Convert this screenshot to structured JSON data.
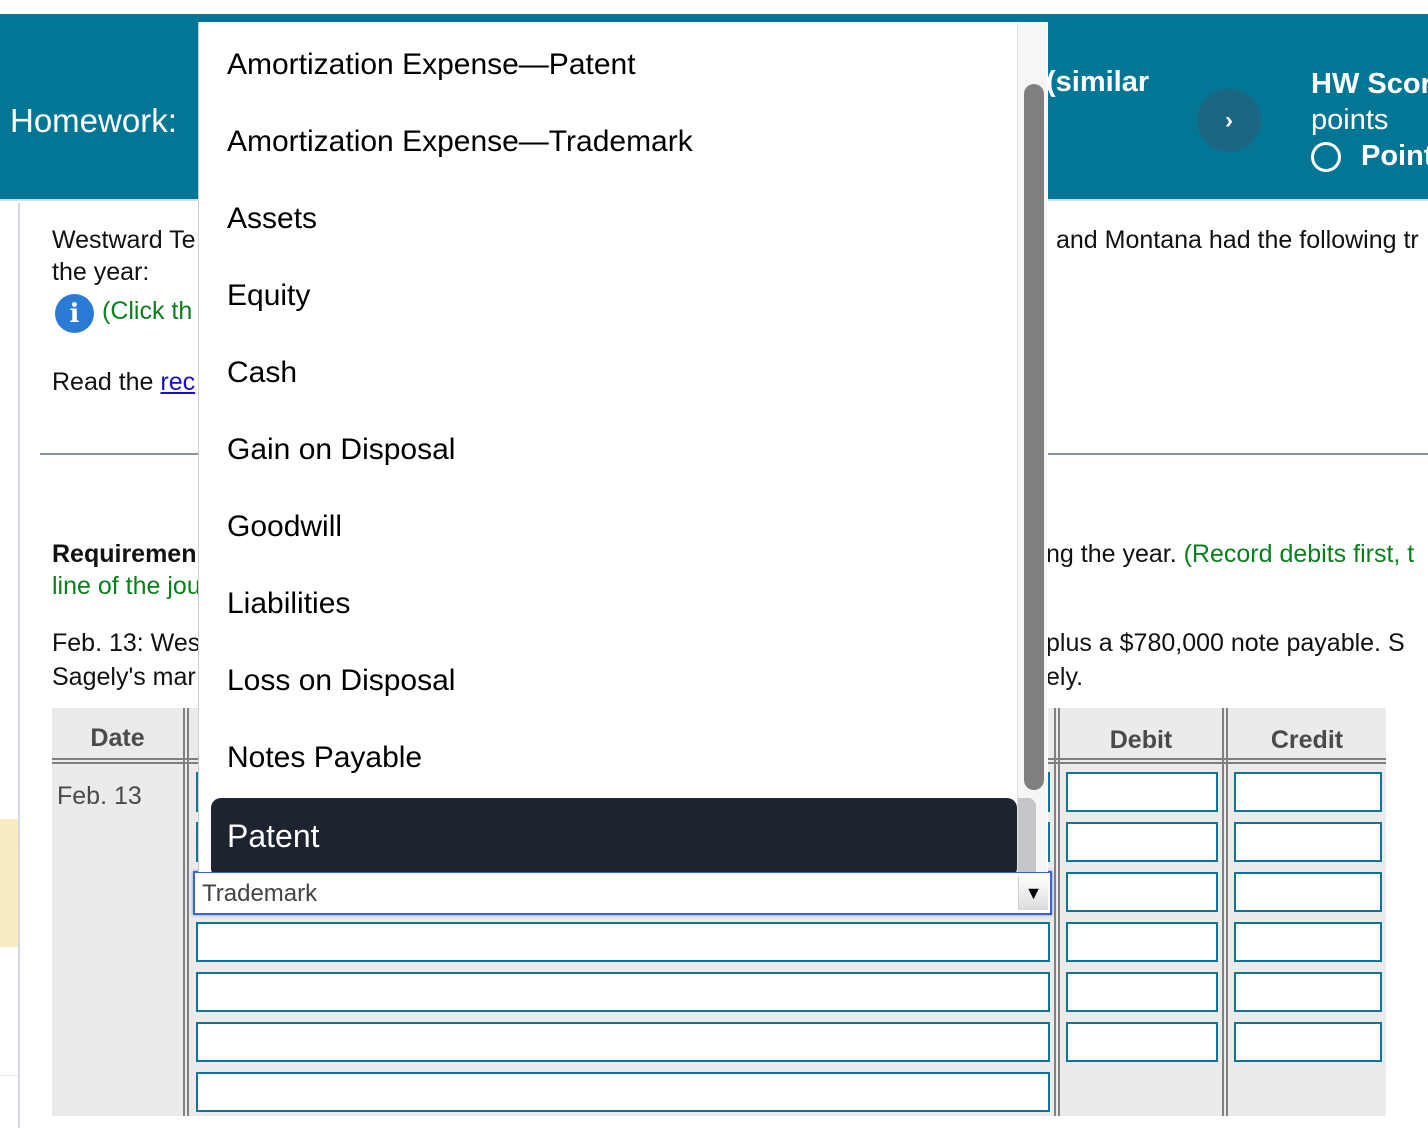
{
  "header": {
    "title": "Homework:",
    "title_fragment_right": "(similar",
    "next_icon": "chevron-right-icon",
    "next_glyph": "›",
    "score_label": "HW Scor",
    "points_label": "points",
    "points_status_label": "Point"
  },
  "problem": {
    "intro_left": "Westward Te",
    "intro_right": "and Montana had the following tr",
    "intro_line2": "the year:",
    "info_icon": "info-icon",
    "click_text": "(Click th",
    "read_prefix": "Read the ",
    "read_link": "rec",
    "requirement_bold": "Requiremen",
    "requirement_right": "ng the year. ",
    "requirement_green_right": "(Record debits first, t",
    "requirement_line2": "line of the jou",
    "transaction_line1_left": "Feb. 13: Wes",
    "transaction_line1_right": "plus a $780,000 note payable. S",
    "transaction_line2_left": "Sagely's mar",
    "transaction_line2_right": "ely."
  },
  "journal": {
    "headers": {
      "date": "Date",
      "debit": "Debit",
      "credit": "Credit"
    },
    "date_value": "Feb. 13",
    "selected_account": "Trademark",
    "rows": 7
  },
  "dropdown": {
    "options": [
      "Amortization Expense—Patent",
      "Amortization Expense—Trademark",
      "Assets",
      "Equity",
      "Cash",
      "Gain on Disposal",
      "Goodwill",
      "Liabilities",
      "Loss on Disposal",
      "Notes Payable",
      "Patent"
    ],
    "highlighted": "Patent",
    "arrow_glyph": "▼"
  }
}
